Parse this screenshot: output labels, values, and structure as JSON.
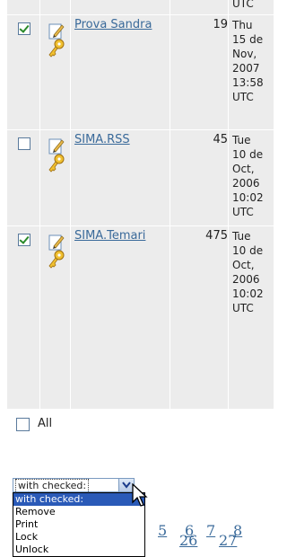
{
  "top_fragment": "UTC",
  "rows": [
    {
      "checked": true,
      "name": "Prova Sandra",
      "count": "19",
      "date": "Thu\n15 de\nNov,\n2007\n13:58\nUTC"
    },
    {
      "checked": false,
      "name": "SIMA.RSS",
      "count": "45",
      "date": "Tue\n10 de\nOct,\n2006\n10:02\nUTC"
    },
    {
      "checked": true,
      "name": "SIMA.Temari",
      "count": "475",
      "date": "Tue\n10 de\nOct,\n2006\n10:02\nUTC"
    }
  ],
  "select_all": {
    "label": "All",
    "checked": false
  },
  "action_select": {
    "value": "with checked:",
    "options": [
      "with checked:",
      "Remove",
      "Print",
      "Lock",
      "Unlock"
    ],
    "selected_index": 0
  },
  "pager": {
    "row1": [
      "5",
      "6",
      "7",
      "8"
    ],
    "row2": [
      "26",
      "27"
    ]
  },
  "icons": {
    "edit": "pencil-icon",
    "lock": "key-icon",
    "dropdown": "chevron-down-icon",
    "pointer": "mouse-cursor-icon"
  },
  "colors": {
    "row_bg": "#ececec",
    "link": "#3a6a9a",
    "selection": "#2a5ab8"
  }
}
